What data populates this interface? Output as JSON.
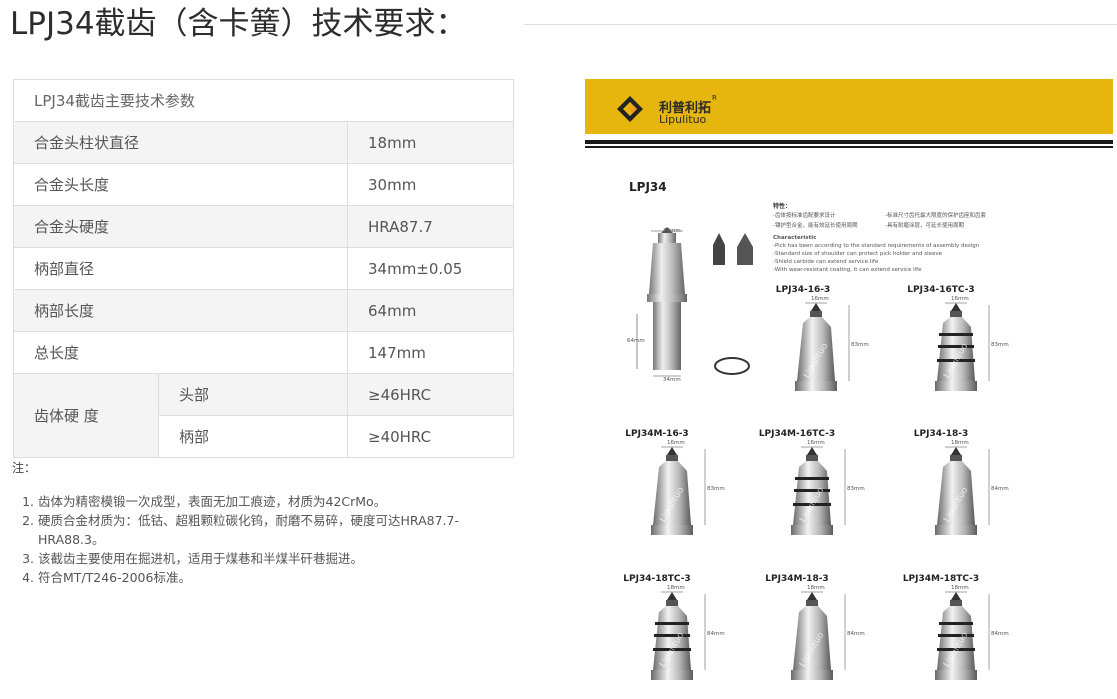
{
  "page": {
    "title": "LPJ34截齿（含卡簧）技术要求："
  },
  "spec_table": {
    "caption": "LPJ34截齿主要技术参数",
    "rows": [
      {
        "label": "合金头柱状直径",
        "value": "18mm"
      },
      {
        "label": "合金头长度",
        "value": "30mm"
      },
      {
        "label": "合金头硬度",
        "value": "HRA87.7"
      },
      {
        "label": "柄部直径",
        "value": "34mm±0.05"
      },
      {
        "label": "柄部长度",
        "value": "64mm"
      },
      {
        "label": "总长度",
        "value": "147mm"
      }
    ],
    "hardness_group": {
      "label": "齿体硬 度",
      "rows": [
        {
          "label": "头部",
          "value": "≥46HRC"
        },
        {
          "label": "柄部",
          "value": "≥40HRC"
        }
      ]
    }
  },
  "notes": {
    "label": "注：",
    "items": [
      "齿体为精密模锻一次成型，表面无加工痕迹，材质为42CrMo。",
      "硬质合金材质为：低钴、超粗颗粒碳化钨，耐磨不易碎，硬度可达HRA87.7-HRA88.3。",
      "该截齿主要使用在掘进机，适用于煤巷和半煤半矸巷掘进。",
      "符合MT/T246-2006标准。"
    ]
  },
  "product_image": {
    "brand_cn": "利普利拓",
    "brand_en": "Lipulituo",
    "brand_mark": "R",
    "model": "LPJ34",
    "features_title": "特性：",
    "features_cn": [
      "-齿体按标准齿配要求设计",
      "-标准尺寸齿托最大限度的保护齿座和齿套",
      "-镶护型合金，能有效延长使用周期",
      "-具有耐磨涂层，可延长使用周期"
    ],
    "features_en_title": "Characteristic",
    "features_en": [
      "-Pick has been according to the standard requirements of assembly design",
      "-Standard size of shoulder can protect pick holder and sleeve",
      "-Shield carbide can extend service life",
      "-With wear-resistant coating, it can extend service life"
    ],
    "variants": [
      "LPJ34-16-3",
      "LPJ34-16TC-3",
      "LPJ34M-16-3",
      "LPJ34M-16TC-3",
      "LPJ34-18-3",
      "LPJ34-18TC-3",
      "LPJ34M-18-3",
      "LPJ34M-18TC-3"
    ],
    "dimension_labels": {
      "main_width": "30mm",
      "main_shank": "64mm",
      "main_dia": "34mm",
      "tip16": "16mm",
      "tip18": "18mm",
      "len83": "83mm",
      "len84": "84mm"
    },
    "watermark": "Lipulituo",
    "colors": {
      "banner": "#e6b60e"
    }
  }
}
